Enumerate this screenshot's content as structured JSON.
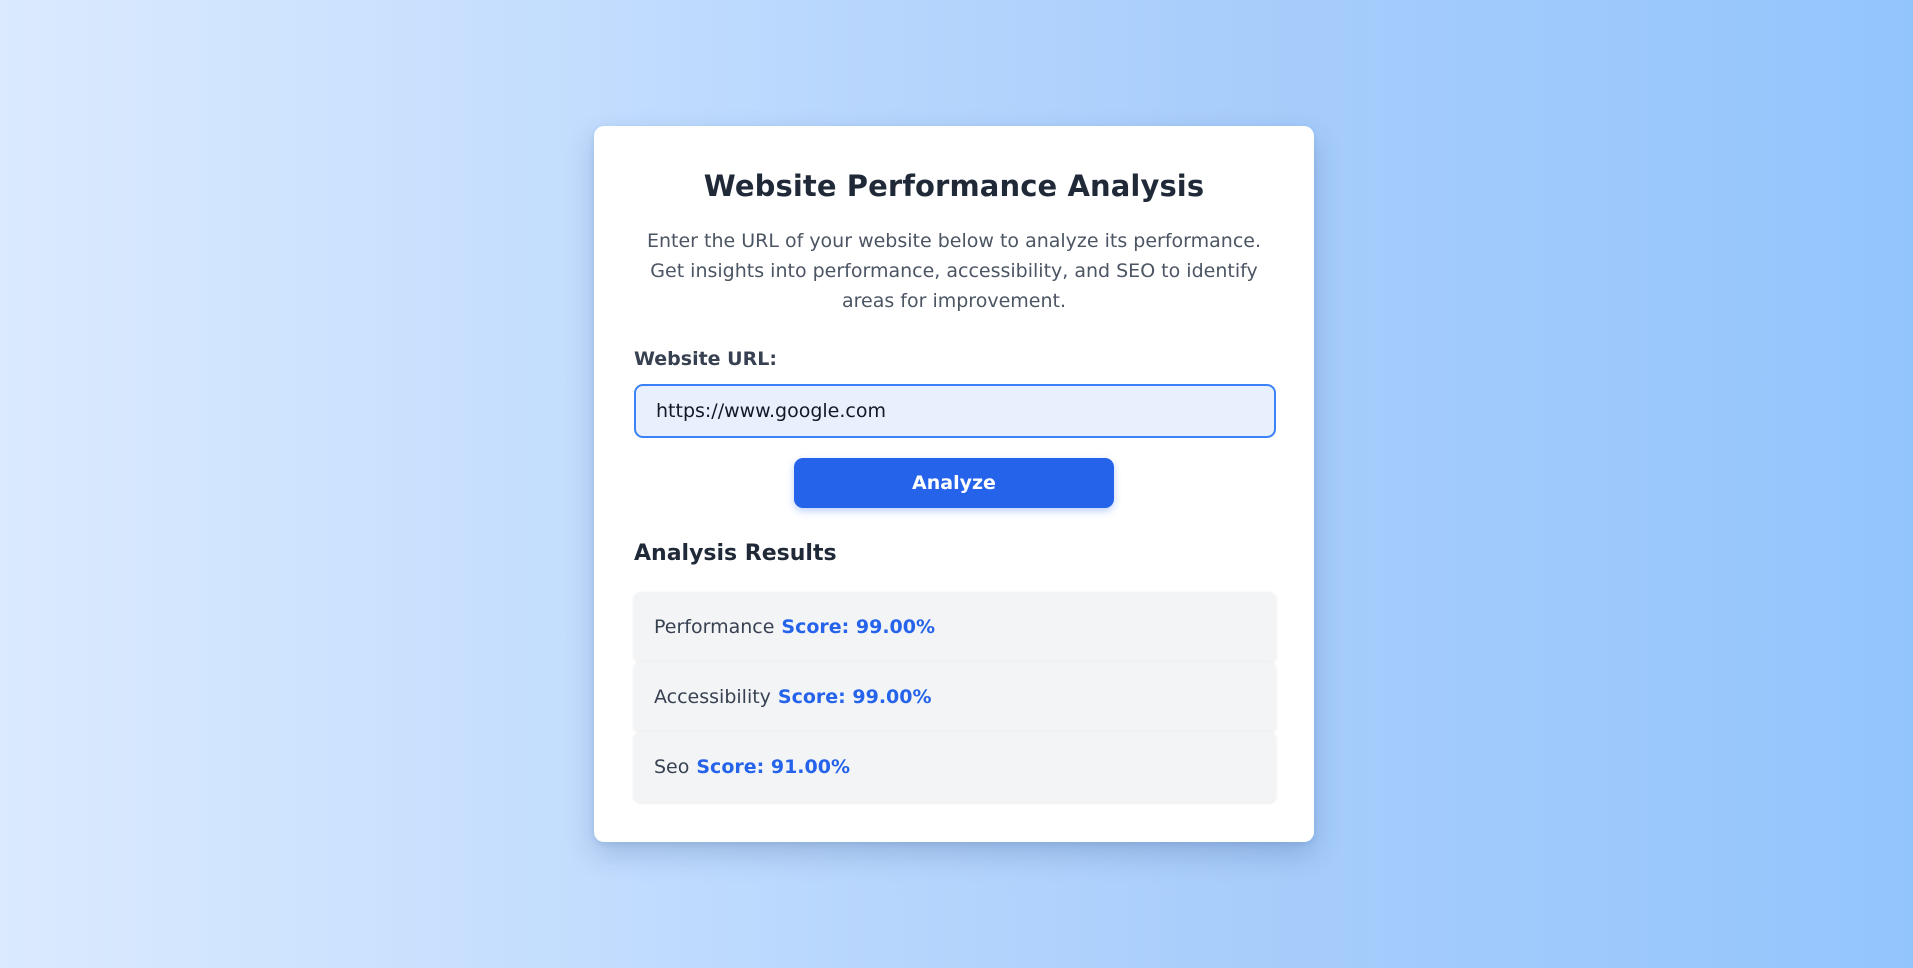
{
  "card": {
    "title": "Website Performance Analysis",
    "description": "Enter the URL of your website below to analyze its performance. Get insights into performance, accessibility, and SEO to identify areas for improvement."
  },
  "form": {
    "url_label": "Website URL:",
    "url_value": "https://www.google.com",
    "analyze_label": "Analyze"
  },
  "results": {
    "heading": "Analysis Results",
    "items": [
      {
        "label": "Performance",
        "score": "Score: 99.00%"
      },
      {
        "label": "Accessibility",
        "score": "Score: 99.00%"
      },
      {
        "label": "Seo",
        "score": "Score: 91.00%"
      }
    ]
  },
  "colors": {
    "accent": "#2563eb",
    "input_border": "#3b82f6",
    "input_bg": "#e8f0fe",
    "result_bg": "#f3f4f6",
    "title_text": "#1f2937"
  }
}
